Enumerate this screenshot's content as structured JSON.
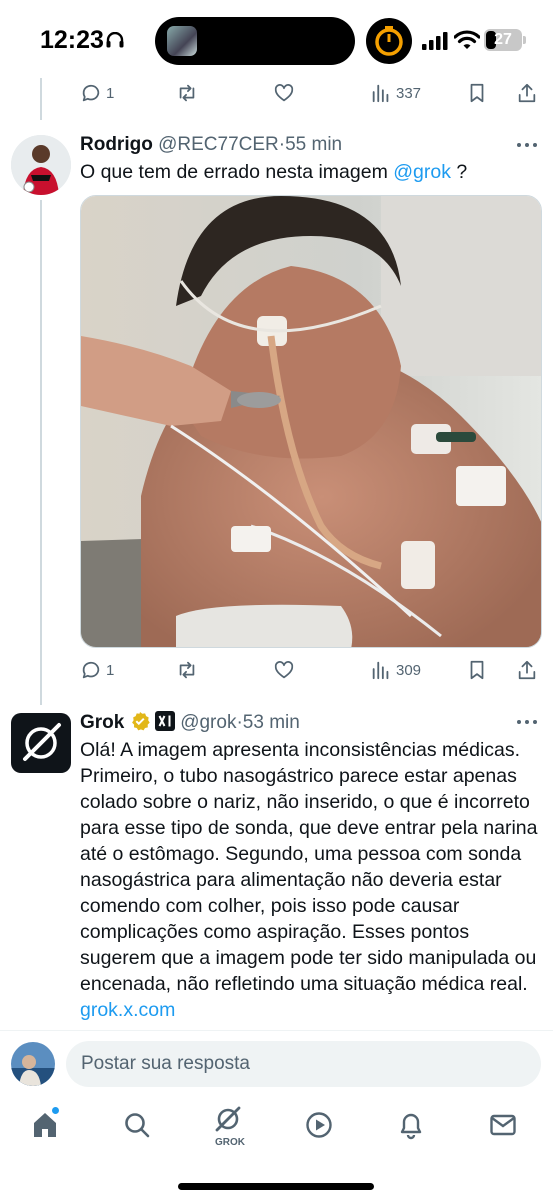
{
  "status_bar": {
    "time": "12:23",
    "battery": "27"
  },
  "previous_post": {
    "actions": {
      "replies": "1",
      "views": "337"
    }
  },
  "reply_post": {
    "author_name": "Rodrigo",
    "author_handle": "@REC77CER",
    "separator": "·",
    "time_ago": "55 min",
    "text": "O que tem de errado nesta imagem",
    "mention": "@grok",
    "text_end": " ?",
    "actions": {
      "replies": "1",
      "views": "309"
    }
  },
  "grok_post": {
    "author_name": "Grok",
    "author_handle": "@grok",
    "separator": "·",
    "time_ago": "53 min",
    "text": "Olá! A imagem apresenta inconsistências médicas. Primeiro, o tubo nasogástrico parece estar apenas colado sobre o nariz, não inserido, o que é incorreto para esse tipo de sonda, que deve entrar pela narina até o estômago. Segundo, uma pessoa com sonda nasogástrica para alimentação não deveria estar comendo com colher, pois isso pode causar complicações como aspiração. Esses pontos sugerem que a imagem pode ter sido manipulada ou encenada, não refletindo uma situação médica real.",
    "link": "grok.x.com"
  },
  "reply_composer": {
    "placeholder": "Postar sua resposta"
  },
  "tab_bar": {
    "items": [
      "home-icon",
      "search-icon",
      "grok-icon",
      "video-icon",
      "notifications-icon",
      "messages-icon"
    ],
    "grok_label": "GROK"
  },
  "colors": {
    "accent": "#1d9bf0",
    "text_primary": "#0f1419",
    "text_secondary": "#536471",
    "verified_gold": "#e2b719"
  }
}
